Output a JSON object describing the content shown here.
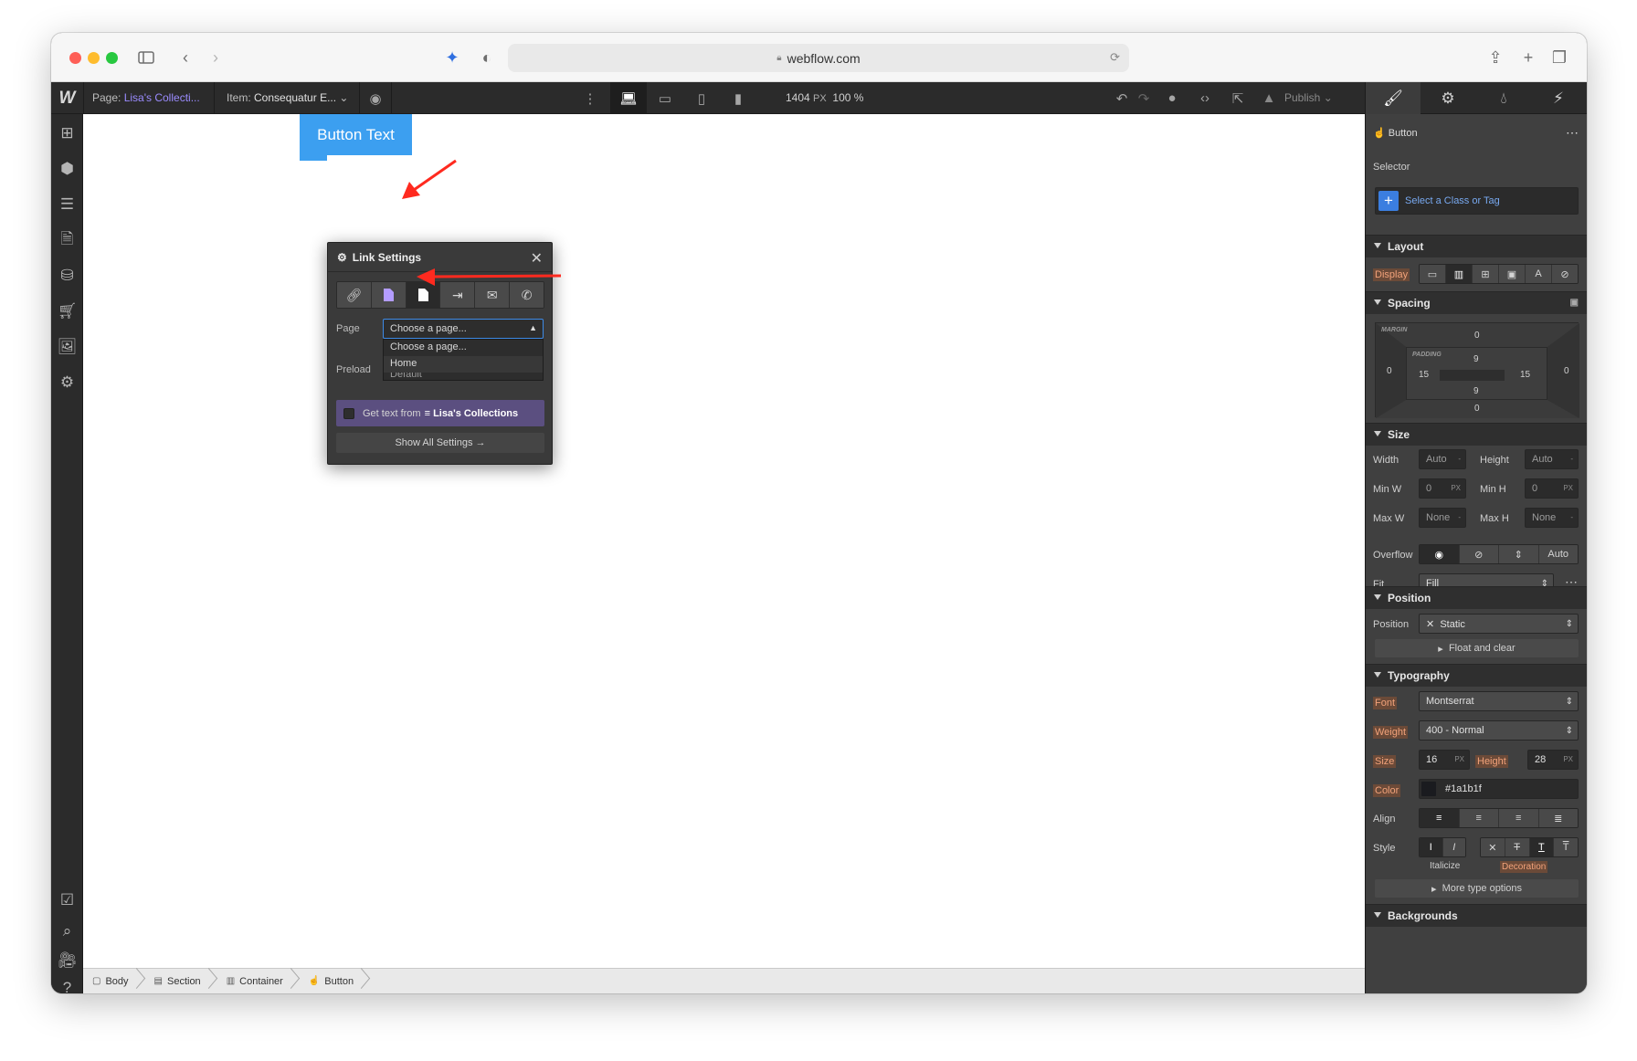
{
  "browser": {
    "url": "webflow.com"
  },
  "toolbar": {
    "page_label": "Page:",
    "page_value": "Lisa's Collecti...",
    "item_label": "Item:",
    "item_value": "Consequatur E...",
    "canvas_width": "1404",
    "canvas_unit": "PX",
    "zoom": "100 %",
    "publish_label": "Publish"
  },
  "canvas": {
    "button_text": "Button Text"
  },
  "link_settings": {
    "title": "Link Settings",
    "page_label": "Page",
    "page_select_value": "Choose a page...",
    "dropdown_options": [
      "Choose a page...",
      "Home"
    ],
    "highlighted_option": "Home",
    "preload_label": "Preload",
    "preload_value": "Default",
    "get_text_from": "Get text from",
    "collection_name": "Lisa's Collections",
    "show_all": "Show All Settings"
  },
  "breadcrumbs": [
    "Body",
    "Section",
    "Container",
    "Button"
  ],
  "style_panel": {
    "element_name": "Button",
    "selector_label": "Selector",
    "selector_placeholder": "Select a Class or Tag",
    "layout": {
      "title": "Layout",
      "display_label": "Display"
    },
    "spacing": {
      "title": "Spacing",
      "margin_tag": "MARGIN",
      "padding_tag": "PADDING",
      "margin": {
        "top": "0",
        "right": "0",
        "bottom": "0",
        "left": "0"
      },
      "padding": {
        "top": "9",
        "right": "15",
        "bottom": "9",
        "left": "15"
      }
    },
    "size": {
      "title": "Size",
      "width_label": "Width",
      "width_value": "Auto",
      "width_unit": "-",
      "height_label": "Height",
      "height_value": "Auto",
      "height_unit": "-",
      "minw_label": "Min W",
      "minw_value": "0",
      "minw_unit": "PX",
      "minh_label": "Min H",
      "minh_value": "0",
      "minh_unit": "PX",
      "maxw_label": "Max W",
      "maxw_value": "None",
      "maxw_unit": "-",
      "maxh_label": "Max H",
      "maxh_value": "None",
      "maxh_unit": "-",
      "overflow_label": "Overflow",
      "overflow_auto": "Auto",
      "fit_label": "Fit",
      "fit_value": "Fill"
    },
    "position": {
      "title": "Position",
      "position_label": "Position",
      "position_value": "Static",
      "float_clear": "Float and clear"
    },
    "typography": {
      "title": "Typography",
      "font_label": "Font",
      "font_value": "Montserrat",
      "weight_label": "Weight",
      "weight_value": "400 - Normal",
      "size_label": "Size",
      "size_value": "16",
      "size_unit": "PX",
      "height_label": "Height",
      "height_value": "28",
      "height_unit": "PX",
      "color_label": "Color",
      "color_value": "#1a1b1f",
      "align_label": "Align",
      "style_label": "Style",
      "italicize": "Italicize",
      "decoration": "Decoration",
      "more_options": "More type options"
    },
    "backgrounds": {
      "title": "Backgrounds"
    }
  },
  "colors": {
    "accent_blue": "#3c9ff0",
    "selector_blue": "#3b7ee0",
    "collection_purple": "#5b4f80",
    "annotation_red": "#ff2a1f",
    "text_color_swatch": "#1a1b1f"
  },
  "icons": {
    "link_types": [
      "link-icon",
      "page-icon-purple",
      "page-icon",
      "section-icon",
      "email-icon",
      "phone-icon"
    ]
  }
}
